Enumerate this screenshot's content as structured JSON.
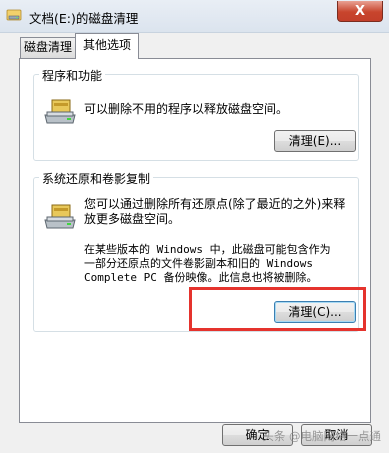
{
  "window": {
    "title": "文档(E:)的磁盘清理",
    "close_glyph": "X"
  },
  "tabs": [
    {
      "label": "磁盘清理",
      "active": false
    },
    {
      "label": "其他选项",
      "active": true
    }
  ],
  "group_programs": {
    "legend": "程序和功能",
    "description": "可以删除不用的程序以释放磁盘空间。",
    "button_label": "清理(E)..."
  },
  "group_restore": {
    "legend": "系统还原和卷影复制",
    "description_line1": "您可以通过删除所有还原点(除了最近的之外)来释",
    "description_line2": "放更多磁盘空间。",
    "note_line1": "在某些版本的 Windows 中，此磁盘可能包含作为",
    "note_line2": "一部分还原点的文件卷影副本和旧的 Windows",
    "note_line3": "Complete PC 备份映像。此信息也将被删除。",
    "button_label": "清理(C)..."
  },
  "footer": {
    "ok_label": "确定",
    "cancel_label": "取消"
  },
  "watermark": "头条 @电脑网络一点通",
  "colors": {
    "highlight": "#e5332d",
    "close": "#c8452d"
  },
  "icons": [
    "folder-drive-icon",
    "drive-icon",
    "close-icon"
  ]
}
